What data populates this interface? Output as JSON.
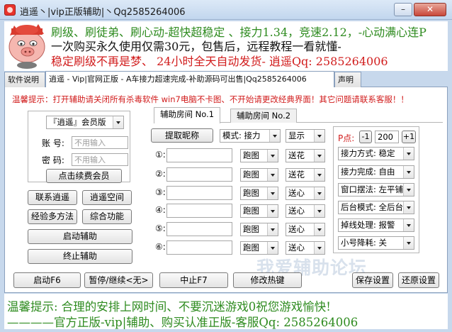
{
  "window": {
    "title": "逍遥丶|vip正版辅助|丶Qq2585264006",
    "minimize": "–",
    "close": "✕"
  },
  "banner": {
    "line1": "刷级、刷徒弟、刷心动-超快超稳定 、接力1.34，竞速2.12，-心动满心连P",
    "line2": "一次购买永久使用仅需30元，包售后，远程教程一看就懂-",
    "line3": "稳定刷级不再是梦、 24小时全天自动发货-  逍遥Qq: 2585264006"
  },
  "tabs": [
    "软件说明",
    "逍遥 - Vip|官网正版 - A车接力超速完成-补助源码可出售|Qq2585264006",
    "声明"
  ],
  "warning": "温馨提示：打开辅助请关闭所有杀毒软件 win7电脑不卡图、不开始请更改经典界面！其它问题请联系客服！！",
  "account": {
    "edition": "『逍遥』会员版",
    "account_label": "账 号:",
    "password_label": "密 码:",
    "account_placeholder": "不用输入",
    "password_placeholder": "不用输入",
    "renew_button": "点击续费会员"
  },
  "left_buttons": {
    "contact": "联系逍遥",
    "space": "逍遥空间",
    "exp": "经验多方法",
    "features": "综合功能",
    "start": "启动辅助",
    "stop": "终止辅助"
  },
  "room_tabs": [
    "辅助房间 No.1",
    "辅助房间 No.2"
  ],
  "room": {
    "get_nick": "提取昵称",
    "mode": "模式: 接力",
    "display": "显示",
    "rows": [
      {
        "label": "①:",
        "action": "跑图",
        "send": "送花"
      },
      {
        "label": "②:",
        "action": "跑图",
        "send": "送花"
      },
      {
        "label": "③:",
        "action": "跑图",
        "send": "送心"
      },
      {
        "label": "④:",
        "action": "跑图",
        "send": "送心"
      },
      {
        "label": "⑤:",
        "action": "跑图",
        "send": "送心"
      },
      {
        "label": "⑥:",
        "action": "跑图",
        "send": "送心"
      }
    ]
  },
  "settings": {
    "p_label": "P点:",
    "minus": "-1",
    "p_value": "200",
    "plus": "+1",
    "options": [
      "接力方式: 稳定",
      "接力完成: 自由",
      "窗口摆法: 左平铺",
      "后台模式: 全后台",
      "掉线处理: 报警",
      "小号降耗: 关"
    ]
  },
  "bottom_buttons": {
    "start": "启动F6",
    "pause": "暂停/继续<无>",
    "abort": "中止F7",
    "hotkey": "修改热键",
    "save": "保存设置",
    "restore": "还原设置"
  },
  "watermark": "我爱辅助论坛",
  "footer": {
    "line1": "温馨提示: 合理的安排上网时间、不要沉迷游戏0祝您游戏愉快!",
    "line2": "————官方正版-vip|辅助、购买认准正版-客服Qq: 2585264006"
  },
  "colors": {
    "warning_red": "#d11c1c",
    "promo_green": "#2e8b1f",
    "panel_bg": "#ffffff",
    "frame_blue": "#c7d8ec"
  },
  "icons": {
    "app": "pig-mascot-icon",
    "banner": "pig-mascot-icon",
    "dropdown": "chevron-down-icon"
  }
}
